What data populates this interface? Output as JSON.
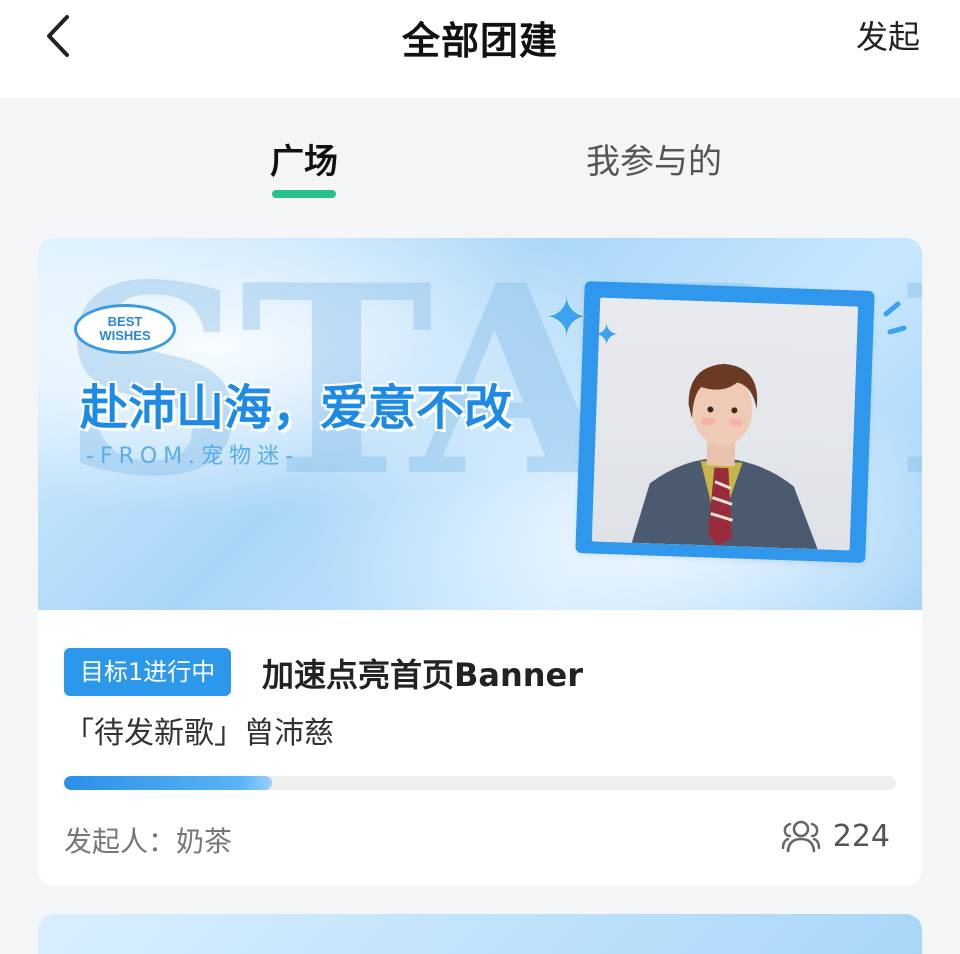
{
  "header": {
    "title": "全部团建",
    "action_label": "发起"
  },
  "tabs": [
    {
      "label": "广场",
      "active": true
    },
    {
      "label": "我参与的",
      "active": false
    }
  ],
  "card": {
    "banner": {
      "background_text": "STAR DR",
      "badge_text": "BEST WISHES",
      "slogan": "赴沛山海，爱意不改",
      "from_line": "-FROM.宠物迷-"
    },
    "status_badge": "目标1进行中",
    "title": "加速点亮首页Banner",
    "song": "「待发新歌」曾沛慈",
    "progress_fraction": 0.25,
    "initiator": "发起人：奶茶",
    "participants_count": "224"
  },
  "colors": {
    "accent_green": "#28c08a",
    "accent_blue": "#2c98ec"
  }
}
